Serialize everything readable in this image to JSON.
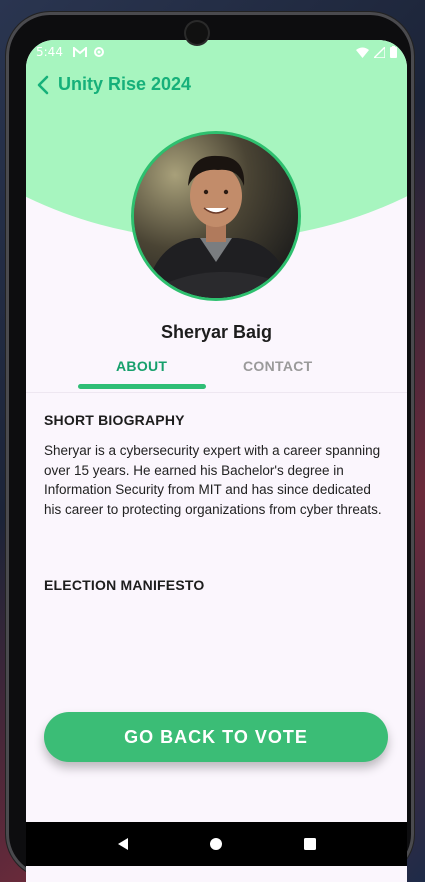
{
  "status_bar": {
    "time": "5:44",
    "left_icons": [
      "gmail-icon",
      "sync-icon"
    ],
    "right_icons": [
      "wifi-icon",
      "signal-icon",
      "battery-icon"
    ]
  },
  "app_bar": {
    "back_icon": "chevron-left-icon",
    "title": "Unity Rise 2024"
  },
  "profile": {
    "name": "Sheryar Baig"
  },
  "tabs": [
    {
      "label": "ABOUT",
      "active": true
    },
    {
      "label": "CONTACT",
      "active": false
    }
  ],
  "about": {
    "biography_heading": "SHORT BIOGRAPHY",
    "biography_text": "Sheryar is a cybersecurity expert with a career spanning over 15 years. He earned his Bachelor's degree in Information Security from MIT and has since dedicated his career to protecting organizations from cyber threats.",
    "manifesto_heading": "ELECTION MANIFESTO"
  },
  "action_button": {
    "label": "GO BACK TO VOTE"
  },
  "nav_bar": {
    "icons": [
      "back-icon",
      "home-icon",
      "recents-icon"
    ]
  },
  "colors": {
    "accent": "#16b07a",
    "header_bg": "#a7f5bf",
    "button": "#3bbd76",
    "background": "#fbf6fd"
  }
}
